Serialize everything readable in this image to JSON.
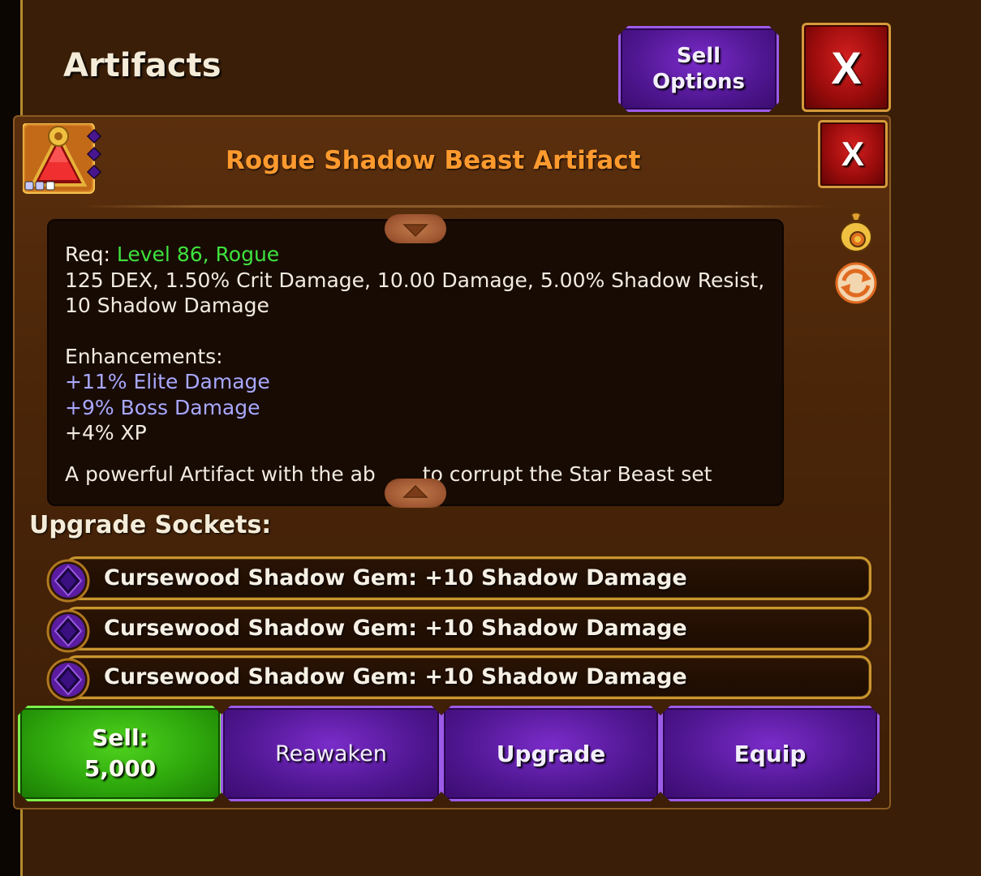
{
  "header": {
    "title": "Artifacts",
    "sell_options_line1": "Sell",
    "sell_options_line2": "Options",
    "close_label": "X"
  },
  "item": {
    "name": "Rogue Shadow Beast Artifact",
    "close_label": "X",
    "icon": "artifact-triangle-icon",
    "rarity_colors": {
      "title": "#ff9a2e"
    }
  },
  "details": {
    "req_label": "Req:",
    "req_level": "Level 86",
    "req_sep": ",",
    "req_class": "Rogue",
    "stats_line1": "125 DEX, 1.50% Crit Damage, 10.00 Damage, 5.00% Shadow Resist,",
    "stats_line2": "10 Shadow Damage",
    "enhancements_label": "Enhancements:",
    "enhancements": [
      "+11% Elite Damage",
      "+9% Boss Damage",
      "+4% XP"
    ],
    "description_partial_left": "A powerful Artifact with the ab",
    "description_partial_right": "to corrupt the Star Beast set"
  },
  "sockets": {
    "label": "Upgrade Sockets:",
    "items": [
      {
        "text": "Cursewood Shadow Gem: +10 Shadow Damage",
        "icon": "shadow-gem-icon"
      },
      {
        "text": "Cursewood Shadow Gem: +10 Shadow Damage",
        "icon": "shadow-gem-icon"
      },
      {
        "text": "Cursewood Shadow Gem: +10 Shadow Damage",
        "icon": "shadow-gem-icon"
      }
    ]
  },
  "actions": {
    "sell_label": "Sell:",
    "sell_price": "5,000",
    "reawaken": "Reawaken",
    "upgrade": "Upgrade",
    "equip": "Equip"
  },
  "side_icons": [
    "money-bag-icon",
    "transmute-icon"
  ]
}
